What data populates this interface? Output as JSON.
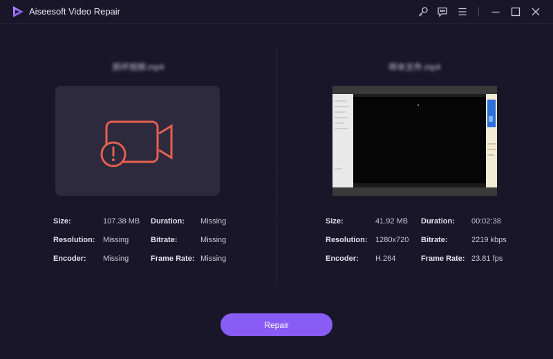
{
  "app": {
    "title": "Aiseesoft Video Repair"
  },
  "titlebar": {
    "icons": [
      "key-icon",
      "feedback-icon",
      "menu-icon",
      "minimize-icon",
      "maximize-icon",
      "close-icon"
    ]
  },
  "left": {
    "filename": "损坏视频.mp4",
    "size_label": "Size:",
    "size": "107.38 MB",
    "duration_label": "Duration:",
    "duration": "Missing",
    "resolution_label": "Resolution:",
    "resolution": "Missing",
    "bitrate_label": "Bitrate:",
    "bitrate": "Missing",
    "encoder_label": "Encoder:",
    "encoder": "Missing",
    "framerate_label": "Frame Rate:",
    "framerate": "Missing"
  },
  "right": {
    "filename": "样本文件.mp4",
    "size_label": "Size:",
    "size": "41.92 MB",
    "duration_label": "Duration:",
    "duration": "00:02:38",
    "resolution_label": "Resolution:",
    "resolution": "1280x720",
    "bitrate_label": "Bitrate:",
    "bitrate": "2219 kbps",
    "encoder_label": "Encoder:",
    "encoder": "H.264",
    "framerate_label": "Frame Rate:",
    "framerate": "23.81 fps"
  },
  "actions": {
    "repair_label": "Repair"
  },
  "colors": {
    "background": "#1a1629",
    "accent": "#8a5cf6",
    "error": "#e8604f"
  }
}
